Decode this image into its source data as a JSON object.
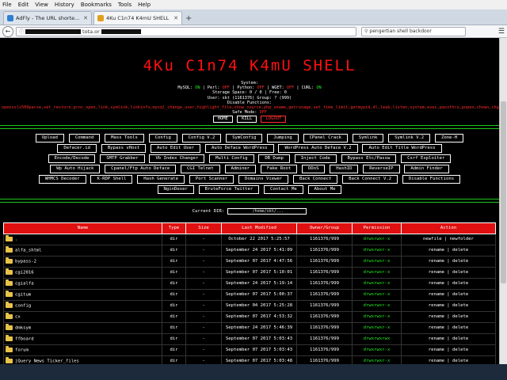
{
  "browser": {
    "menu": [
      "File",
      "Edit",
      "View",
      "History",
      "Bookmarks",
      "Tools",
      "Help"
    ],
    "tabs": [
      {
        "label": "AdFly - The URL shortener se...",
        "active": false,
        "color": "#2e7fd1"
      },
      {
        "label": "4Ku C1n74 K4mU SHELL",
        "active": true,
        "color": "#e0a020"
      }
    ],
    "url_suffix": "tota.or",
    "search_value": "pengertian shell backdoor"
  },
  "page": {
    "title": "4Ku C1n74 K4mU SHELL",
    "system_label": "System:",
    "mysql_label": "MySQL:",
    "mysql": "ON",
    "perl_label": "Perl:",
    "perl": "OFF",
    "python_label": "Python:",
    "python": "OFF",
    "wget_label": "WGET:",
    "wget": "OFF",
    "curl_label": "CURL:",
    "curl": "ON",
    "storage": "Storage Space: 0 / 0 | Free: 0",
    "user": "User: skt   (1161376) Group: ? (999)",
    "disable_label": "Disable Functions:",
    "disabled_functions": "opensslx509parse,set_restore,proc_open,link,symlink,linkinfo,mysql_change_user,highlight_file,show_source,php_uname,getrusage,set_time_limit,getmypid,dl,leak,listen,system,exec,passthru,popen,chown,chgrp,diskfreespace,disk_free_space",
    "safe_mode_label": "Safe Mode:",
    "safe_mode": "OFF",
    "controls": [
      "HOME",
      "KILL",
      "LOGOUT"
    ],
    "tools": [
      "Upload",
      "Command",
      "Mass Tools",
      "Config",
      "Config V.2",
      "SymConfig",
      "Jumping",
      "CPanel Crack",
      "Symlink",
      "Symlink V.2",
      "Zone-H",
      "Defacer.id",
      "Bypass vHost",
      "Auto Edit User",
      "Auto Deface WordPress",
      "WordPress Auto Deface V.2",
      "Auto Edit Title WordPress",
      "Encode/Decode",
      "SMTP Grabber",
      "Vb Index Changer",
      "Multi Config",
      "DB Dump",
      "Inject Code",
      "Bypass Etc/Passw",
      "Csrf Exploiter",
      "Wp Auto Hijack",
      "Cpanel/Ftp Auto Deface",
      "CGI Telnet",
      "Adminer",
      "Fake Root",
      "DDoS",
      "HashID",
      "ReverseIP",
      "Admin Finder",
      "WHMCS Decoder",
      "K-RDP Shell",
      "Hash Generate",
      "Port Scanner",
      "Domains Viewer",
      "Back Connect",
      "Back Connect V.2",
      "Disable Functions",
      "NginDexer",
      "BruteForce Twitter",
      "Contact Me",
      "About Me"
    ],
    "current_dir_label": "Current DIR:",
    "current_dir": "/home/skt/..."
  },
  "table": {
    "headers": [
      "Name",
      "Type",
      "Size",
      "Last Modified",
      "Owner/Group",
      "Permission",
      "Action"
    ],
    "rows": [
      {
        "name": ".",
        "type": "dir",
        "size": "-",
        "modified": "October 22 2017 5:25:57",
        "owner": "1161376/999",
        "perm": "drwxrwxr-x",
        "action": "newfile | newfolder"
      },
      {
        "name": "alfa_shtml",
        "type": "dir",
        "size": "-",
        "modified": "September 24 2017 5:41:09",
        "owner": "1161376/999",
        "perm": "drwxrwxr-x",
        "action": "rename | delete"
      },
      {
        "name": "bypass-2",
        "type": "dir",
        "size": "-",
        "modified": "September 07 2017 4:47:56",
        "owner": "1161376/999",
        "perm": "drwxrwxr-x",
        "action": "rename | delete"
      },
      {
        "name": "cgi2016",
        "type": "dir",
        "size": "-",
        "modified": "September 07 2017 5:10:01",
        "owner": "1161376/999",
        "perm": "drwxrwxr-x",
        "action": "rename | delete"
      },
      {
        "name": "cgialfa",
        "type": "dir",
        "size": "-",
        "modified": "September 24 2017 5:19:14",
        "owner": "1161376/999",
        "perm": "drwxrwxr-x",
        "action": "rename | delete"
      },
      {
        "name": "cgitum",
        "type": "dir",
        "size": "-",
        "modified": "September 07 2017 5:00:37",
        "owner": "1161376/999",
        "perm": "drwxrwxr-x",
        "action": "rename | delete"
      },
      {
        "name": "config",
        "type": "dir",
        "size": "-",
        "modified": "September 04 2017 5:25:28",
        "owner": "1161376/999",
        "perm": "drwxrwxr-x",
        "action": "rename | delete"
      },
      {
        "name": "cx",
        "type": "dir",
        "size": "-",
        "modified": "September 07 2017 4:53:32",
        "owner": "1161376/999",
        "perm": "drwxrwxr-x",
        "action": "rename | delete"
      },
      {
        "name": "dmksym",
        "type": "dir",
        "size": "-",
        "modified": "September 24 2017 5:46:39",
        "owner": "1161376/999",
        "perm": "drwxrwxr-x",
        "action": "rename | delete"
      },
      {
        "name": "ffboard",
        "type": "dir",
        "size": "-",
        "modified": "September 07 2017 5:03:43",
        "owner": "1161376/999",
        "perm": "drwxrwxrwx",
        "action": "rename | delete"
      },
      {
        "name": "forum",
        "type": "dir",
        "size": "-",
        "modified": "September 07 2017 5:03:43",
        "owner": "1161376/999",
        "perm": "drwxrwxr-x",
        "action": "rename | delete"
      },
      {
        "name": "jQuery News Ticker_files",
        "type": "dir",
        "size": "-",
        "modified": "September 07 2017 5:03:48",
        "owner": "1161376/999",
        "perm": "drwxrwxr-x",
        "action": "rename | delete"
      }
    ]
  },
  "colors": {
    "accent_red": "#e01010",
    "ok_green": "#22ee22",
    "background": "#000000"
  }
}
